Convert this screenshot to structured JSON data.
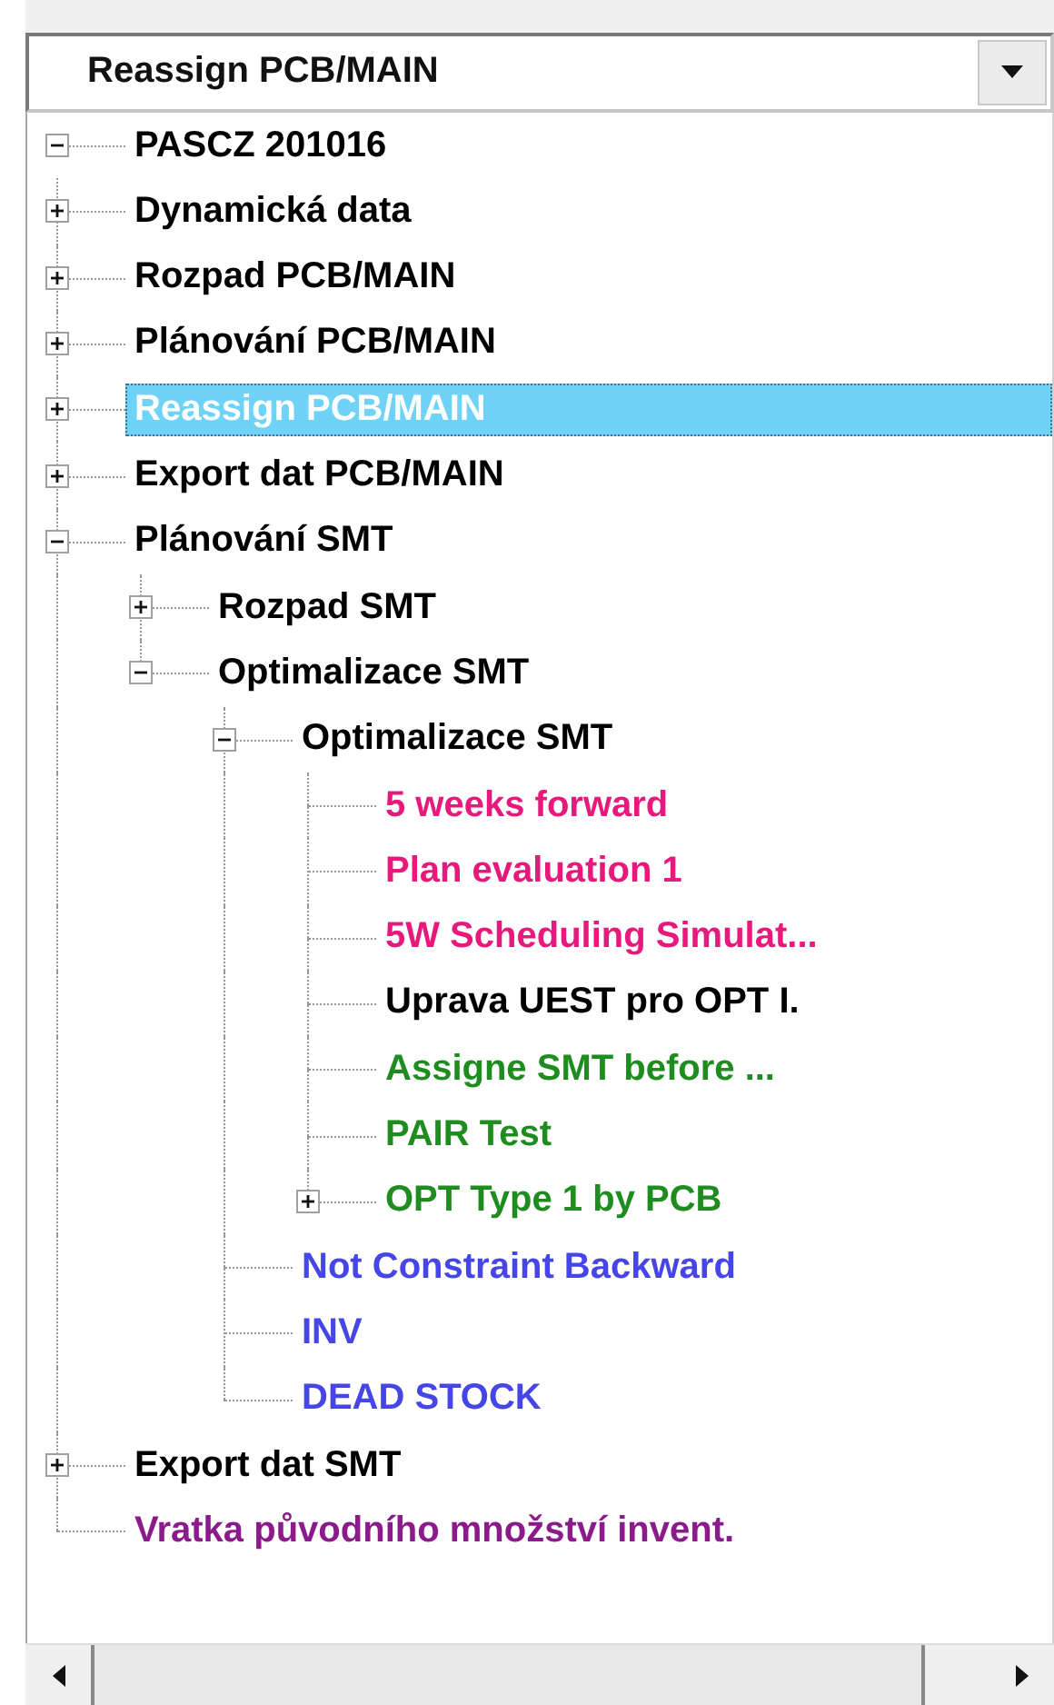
{
  "dropdown": {
    "value": "Reassign PCB/MAIN"
  },
  "tree": {
    "nodes": [
      {
        "label": "PASCZ 201016",
        "color": "#000000",
        "selected": false,
        "expanded": true,
        "children": [
          {
            "label": "Dynamická data",
            "color": "#000000",
            "selected": false,
            "expanded": false
          },
          {
            "label": "Rozpad PCB/MAIN",
            "color": "#000000",
            "selected": false,
            "expanded": false
          },
          {
            "label": "Plánování PCB/MAIN",
            "color": "#000000",
            "selected": false,
            "expanded": false
          },
          {
            "label": "Reassign PCB/MAIN",
            "selected": true,
            "expanded": false
          },
          {
            "label": "Export dat PCB/MAIN",
            "color": "#000000",
            "selected": false,
            "expanded": false
          },
          {
            "label": "Plánování SMT",
            "color": "#000000",
            "selected": false,
            "expanded": true,
            "children": [
              {
                "label": "Rozpad SMT",
                "color": "#000000",
                "selected": false,
                "expanded": false
              },
              {
                "label": "Optimalizace SMT",
                "color": "#000000",
                "selected": false,
                "expanded": true,
                "children": [
                  {
                    "label": "Optimalizace SMT",
                    "color": "#000000",
                    "selected": false,
                    "expanded": true,
                    "children": [
                      {
                        "label": "5 weeks forward",
                        "color": "#e8197d",
                        "selected": false
                      },
                      {
                        "label": "Plan evaluation 1",
                        "color": "#e8197d",
                        "selected": false
                      },
                      {
                        "label": "5W Scheduling Simulat...",
                        "color": "#e8197d",
                        "selected": false
                      },
                      {
                        "label": "Uprava UEST pro OPT I.",
                        "color": "#000000",
                        "selected": false
                      },
                      {
                        "label": "Assigne SMT before ...",
                        "color": "#1f8c1f",
                        "selected": false
                      },
                      {
                        "label": "PAIR Test",
                        "color": "#1f8c1f",
                        "selected": false
                      },
                      {
                        "label": "OPT Type 1 by PCB",
                        "color": "#1f8c1f",
                        "selected": false,
                        "expanded": false
                      }
                    ]
                  },
                  {
                    "label": "Not Constraint Backward",
                    "color": "#4646e6",
                    "selected": false
                  },
                  {
                    "label": "INV",
                    "color": "#4646e6",
                    "selected": false
                  },
                  {
                    "label": "DEAD STOCK",
                    "color": "#4646e6",
                    "selected": false
                  }
                ]
              }
            ]
          },
          {
            "label": "Export dat SMT",
            "color": "#000000",
            "selected": false,
            "expanded": false
          },
          {
            "label": "Vratka původního množství invent.",
            "color": "#8b1a8b",
            "selected": false
          }
        ]
      }
    ]
  }
}
